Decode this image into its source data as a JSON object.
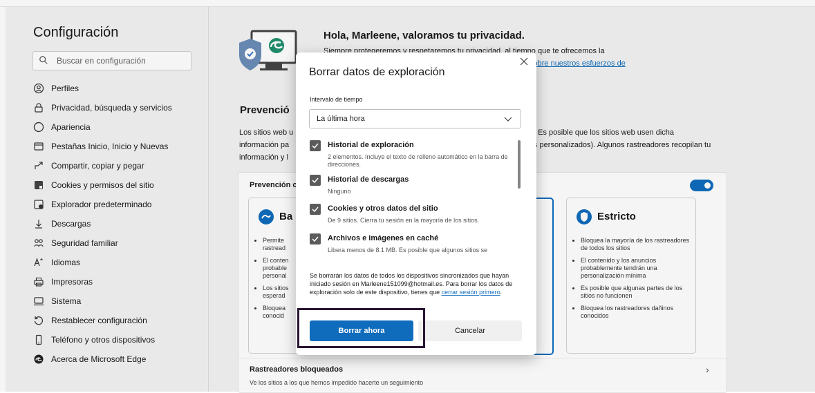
{
  "sidebar": {
    "title": "Configuración",
    "search_placeholder": "Buscar en configuración",
    "items": [
      {
        "label": "Perfiles",
        "icon": "profile-icon"
      },
      {
        "label": "Privacidad, búsqueda y servicios",
        "icon": "lock-icon"
      },
      {
        "label": "Apariencia",
        "icon": "appearance-icon"
      },
      {
        "label": "Pestañas Inicio, Inicio y Nuevas",
        "icon": "tabs-icon"
      },
      {
        "label": "Compartir, copiar y pegar",
        "icon": "share-icon"
      },
      {
        "label": "Cookies y permisos del sitio",
        "icon": "cookies-icon"
      },
      {
        "label": "Explorador predeterminado",
        "icon": "default-browser-icon"
      },
      {
        "label": "Descargas",
        "icon": "download-icon"
      },
      {
        "label": "Seguridad familiar",
        "icon": "family-icon"
      },
      {
        "label": "Idiomas",
        "icon": "language-icon"
      },
      {
        "label": "Impresoras",
        "icon": "printer-icon"
      },
      {
        "label": "Sistema",
        "icon": "system-icon"
      },
      {
        "label": "Restablecer configuración",
        "icon": "reset-icon"
      },
      {
        "label": "Teléfono y otros dispositivos",
        "icon": "phone-icon"
      },
      {
        "label": "Acerca de Microsoft Edge",
        "icon": "edge-icon"
      }
    ]
  },
  "main": {
    "hero_title": "Hola, Marleene, valoramos tu privacidad.",
    "hero_line1": "Siempre protegeremos y respetaremos tu privacidad, al tiempo que te ofrecemos la",
    "hero_link": "sobre nuestros esfuerzos de",
    "section_title": "Prevenció",
    "desc1a": "Los sitios web u",
    "desc1b": ". Es posible que los sitios web usen dicha",
    "desc2a": "información pa",
    "desc2b": "s personalizados). Algunos rastreadores recopilan tu",
    "desc3a": "información y l",
    "card_title": "Prevención c",
    "option_basic": {
      "title": "Ba",
      "bullets": [
        "Permite",
        "El conten",
        "Los sitios",
        "Bloquea"
      ],
      "bullets_l2": [
        "rastread",
        "probable",
        "esperad",
        "conocid"
      ],
      "bullets_l3": [
        "",
        "personal",
        "",
        ""
      ]
    },
    "option_strict": {
      "title": "Estricto",
      "bullets": [
        "Bloquea la mayoría de los rastreadores de todos los sitios",
        "El contenido y los anuncios probablemente tendrán una personalización mínima",
        "Es posible que algunas partes de los sitios no funcionen",
        "Bloquea los rastreadores dañinos conocidos"
      ]
    },
    "trackers_title": "Rastreadores bloqueados",
    "trackers_desc": "Ve los sitios a los que hemos impedido hacerte un seguimiento"
  },
  "dialog": {
    "title": "Borrar datos de exploración",
    "interval_label": "Intervalo de tiempo",
    "interval_value": "La última hora",
    "items": [
      {
        "title": "Historial de exploración",
        "desc": "2 elementos. Incluye el texto de relleno automático en la barra de direcciones.",
        "checked": true
      },
      {
        "title": "Historial de descargas",
        "desc": "Ninguno",
        "checked": true
      },
      {
        "title": "Cookies y otros datos del sitio",
        "desc": "De 9 sitios. Cierra tu sesión en la mayoría de los sitios.",
        "checked": true
      },
      {
        "title": "Archivos e imágenes en caché",
        "desc": "Libera menos de 8.1 MB. Es posible que algunos sitios se",
        "checked": true
      }
    ],
    "info_text": "Se borrarán los datos de todos los dispositivos sincronizados que hayan iniciado sesión en Marleene151099@hotmail.es. Para borrar los datos de exploración solo de este dispositivo, tienes que ",
    "info_link": "cerrar sesión primero",
    "info_end": ".",
    "primary_button": "Borrar ahora",
    "secondary_button": "Cancelar"
  },
  "colors": {
    "accent": "#0f6cbd",
    "highlight_border": "#2a1634"
  }
}
